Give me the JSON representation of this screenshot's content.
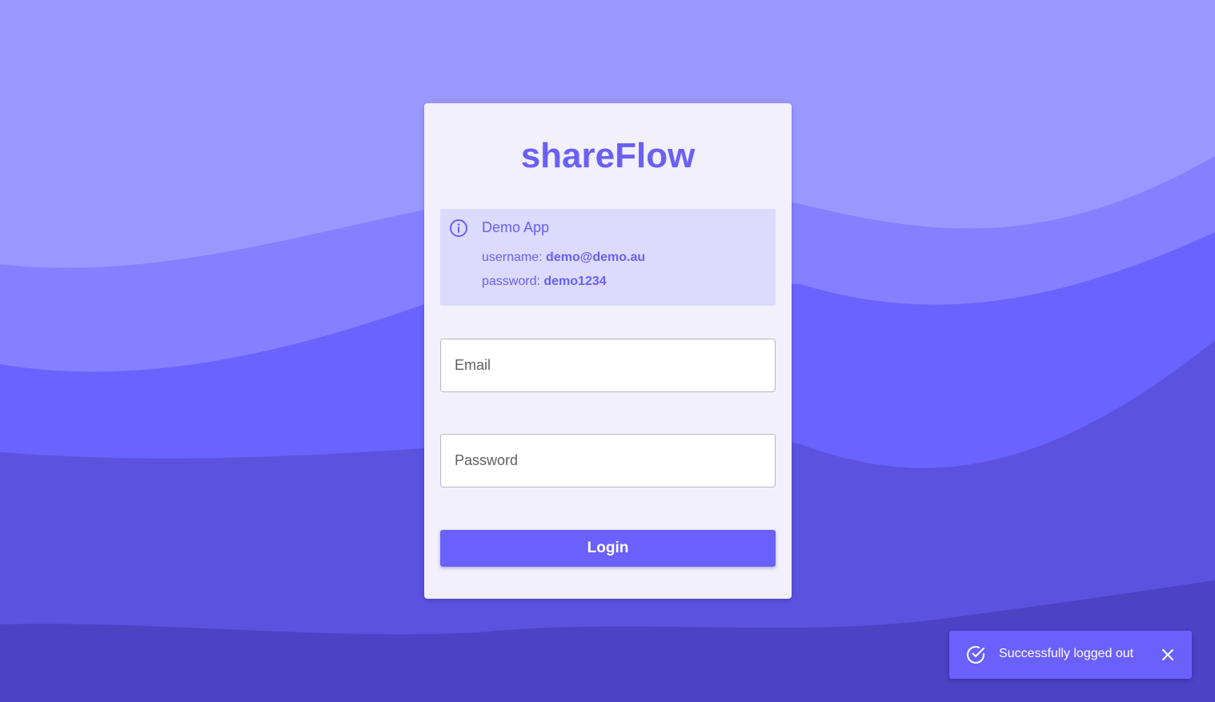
{
  "app": {
    "brand": "shareFlow"
  },
  "info_box": {
    "icon": "info-icon",
    "title": "Demo App",
    "username_label": "username:",
    "username_value": "demo@demo.au",
    "password_label": "password:",
    "password_value": "demo1234"
  },
  "form": {
    "email_placeholder": "Email",
    "password_placeholder": "Password",
    "login_label": "Login"
  },
  "toast": {
    "icon": "check-circle-icon",
    "message": "Successfully logged out",
    "close_icon": "close-icon"
  },
  "colors": {
    "accent": "#6a60fc",
    "background_light": "#9a97ff",
    "card": "#f1f0fb",
    "info_bg": "#dcdafd"
  }
}
